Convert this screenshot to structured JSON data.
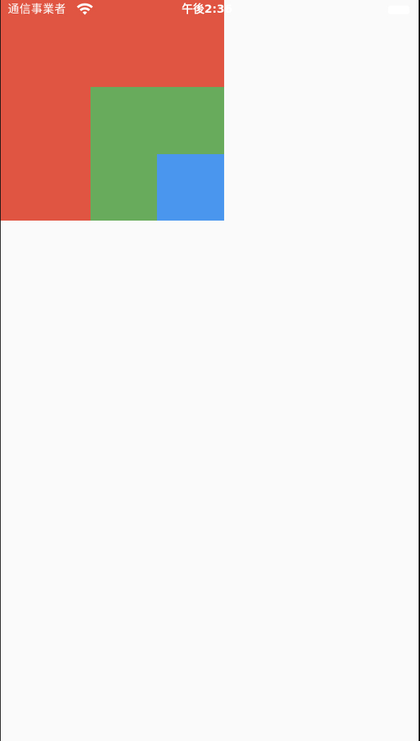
{
  "status_bar": {
    "carrier": "通信事業者",
    "time": "午後2:36",
    "wifi_icon": "wifi-icon",
    "battery_icon": "battery-icon"
  },
  "boxes": {
    "outer": {
      "color": "#e05541"
    },
    "middle": {
      "color": "#68ab5c"
    },
    "inner": {
      "color": "#4a95ee"
    }
  },
  "colors": {
    "background": "#fafafa",
    "status_text": "#ffffff"
  }
}
